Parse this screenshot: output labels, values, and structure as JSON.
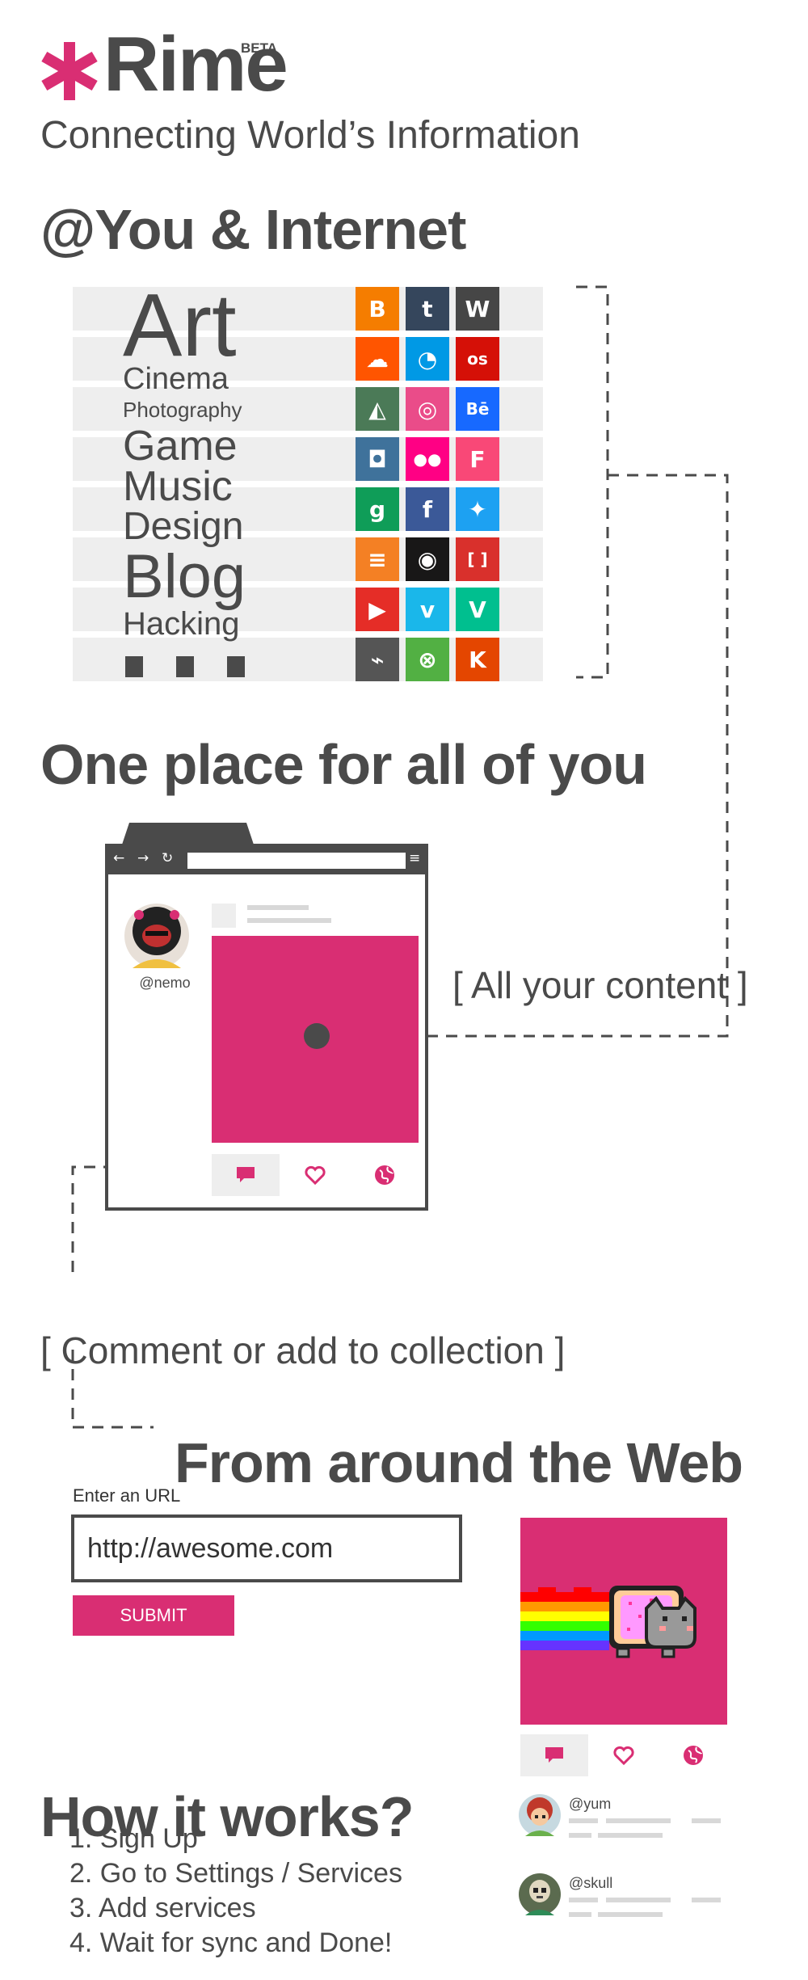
{
  "brand": {
    "name": "Rime",
    "badge": "BETA",
    "accent": "#d92e73",
    "text_color": "#4a4a4a"
  },
  "tagline": "Connecting World’s Information",
  "section_you": {
    "title": "@You & Internet"
  },
  "categories": [
    {
      "label": "Art",
      "icon": "art-glyph"
    },
    {
      "label": "Cinema"
    },
    {
      "label": "Photography"
    },
    {
      "label": "Game"
    },
    {
      "label": "Music"
    },
    {
      "label": "Design"
    },
    {
      "label": "Blog"
    },
    {
      "label": "Hacking"
    }
  ],
  "services": [
    {
      "name": "blogger-icon",
      "color": "#f57d00",
      "glyph": "B"
    },
    {
      "name": "tumblr-icon",
      "color": "#35465c",
      "glyph": "t"
    },
    {
      "name": "wordpress-icon",
      "color": "#464646",
      "glyph": "W"
    },
    {
      "name": "soundcloud-icon",
      "color": "#ff5500",
      "glyph": "☁"
    },
    {
      "name": "500px-icon",
      "color": "#0099e5",
      "glyph": "◔"
    },
    {
      "name": "lastfm-icon",
      "color": "#d51007",
      "glyph": "os"
    },
    {
      "name": "deviantart-icon",
      "color": "#4b7a57",
      "glyph": "◭"
    },
    {
      "name": "dribbble-icon",
      "color": "#ea4c89",
      "glyph": "◎"
    },
    {
      "name": "behance-icon",
      "color": "#1769ff",
      "glyph": "Bē"
    },
    {
      "name": "instagram-icon",
      "color": "#3f729b",
      "glyph": "◘"
    },
    {
      "name": "flickr-icon",
      "color": "#ff0084",
      "glyph": "●●"
    },
    {
      "name": "foursquare-icon",
      "color": "#f94877",
      "glyph": "F"
    },
    {
      "name": "google-plus-icon",
      "color": "#0f9d58",
      "glyph": "g"
    },
    {
      "name": "facebook-icon",
      "color": "#3b5998",
      "glyph": "f"
    },
    {
      "name": "twitter-icon",
      "color": "#1da1f2",
      "glyph": "✦"
    },
    {
      "name": "stackoverflow-icon",
      "color": "#f48024",
      "glyph": "≡"
    },
    {
      "name": "github-icon",
      "color": "#181717",
      "glyph": "◉"
    },
    {
      "name": "brackets-icon",
      "color": "#d9302c",
      "glyph": "[ ]"
    },
    {
      "name": "youtube-icon",
      "color": "#e52d27",
      "glyph": "▶"
    },
    {
      "name": "vimeo-icon",
      "color": "#1ab7ea",
      "glyph": "v"
    },
    {
      "name": "vine-icon",
      "color": "#00bf8f",
      "glyph": "V"
    },
    {
      "name": "steam-icon",
      "color": "#555555",
      "glyph": "⌁"
    },
    {
      "name": "xbox-icon",
      "color": "#52b043",
      "glyph": "⊗"
    },
    {
      "name": "klout-icon",
      "color": "#e44600",
      "glyph": "K"
    }
  ],
  "section_one_place": {
    "title": "One place for all of you"
  },
  "profile": {
    "username": "@nemo"
  },
  "callouts": {
    "content": "[ All your content ]",
    "comment": "[ Comment or add to collection ]"
  },
  "section_web": {
    "title": "From around the Web"
  },
  "url_form": {
    "label": "Enter an URL",
    "value": "http://awesome.com",
    "submit": "SUBMIT"
  },
  "comments": [
    {
      "user": "@yum"
    },
    {
      "user": "@skull"
    }
  ],
  "section_how": {
    "title": "How it works?"
  },
  "steps": [
    "1. Sign Up",
    "2. Go to Settings / Services",
    "3. Add services",
    "4. Wait for sync and Done!"
  ]
}
